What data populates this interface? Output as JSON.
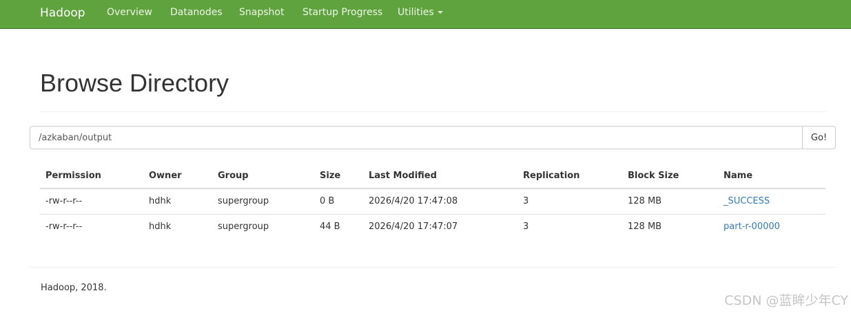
{
  "navbar": {
    "brand": "Hadoop",
    "items": [
      {
        "label": "Overview"
      },
      {
        "label": "Datanodes"
      },
      {
        "label": "Snapshot"
      },
      {
        "label": "Startup Progress"
      },
      {
        "label": "Utilities"
      }
    ],
    "color": "#5fa33e"
  },
  "page": {
    "title": "Browse Directory"
  },
  "path_bar": {
    "value": "/azkaban/output",
    "go_label": "Go!"
  },
  "table": {
    "headers": [
      "Permission",
      "Owner",
      "Group",
      "Size",
      "Last Modified",
      "Replication",
      "Block Size",
      "Name"
    ],
    "rows": [
      [
        "-rw-r--r--",
        "hdhk",
        "supergroup",
        "0 B",
        "2026/4/20 17:47:08",
        "3",
        "128 MB",
        "_SUCCESS"
      ],
      [
        "-rw-r--r--",
        "hdhk",
        "supergroup",
        "44 B",
        "2026/4/20 17:47:07",
        "3",
        "128 MB",
        "part-r-00000"
      ]
    ]
  },
  "footer": {
    "text": "Hadoop, 2018."
  },
  "watermark": "CSDN @蓝眸少年CY",
  "link_color": "#337ab7"
}
